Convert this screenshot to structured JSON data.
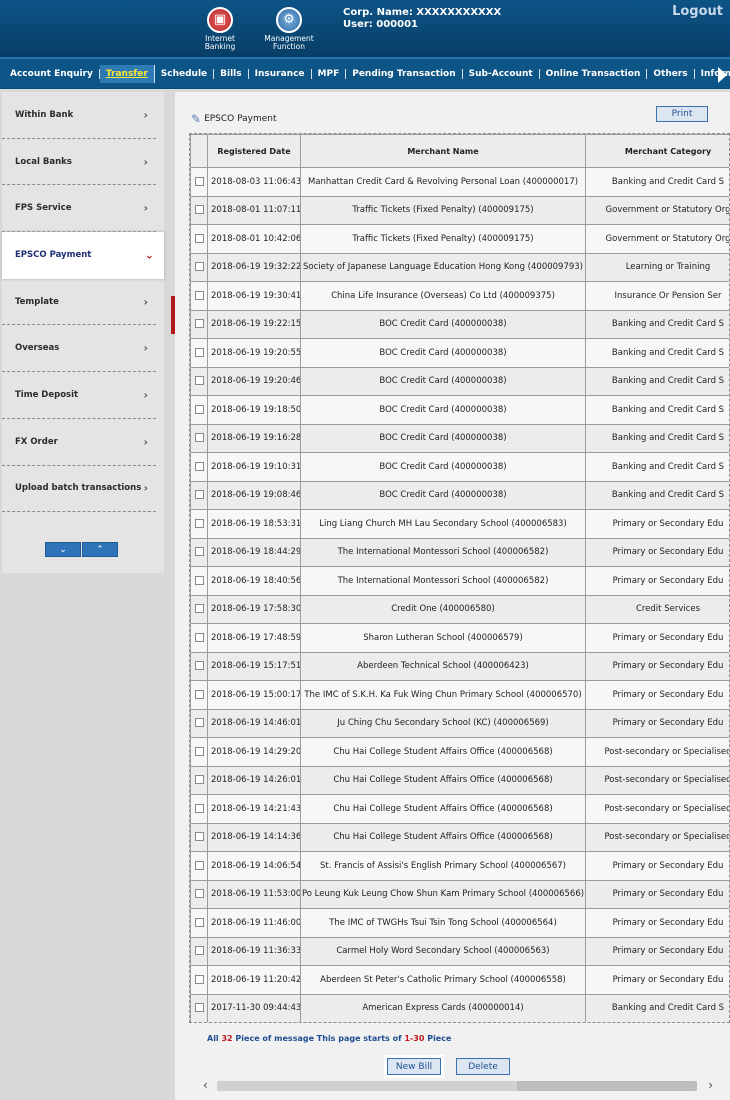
{
  "header": {
    "internet_banking": "Internet Banking",
    "management_function": "Management Function",
    "corp_name": "Corp. Name: XXXXXXXXXXX",
    "user": "User: 000001",
    "logout": "Logout"
  },
  "nav": [
    "Account Enquiry",
    "Transfer",
    "Schedule",
    "Bills",
    "Insurance",
    "MPF",
    "Pending Transaction",
    "Sub-Account",
    "Online Transaction",
    "Others",
    "Inform"
  ],
  "sidebar": {
    "items": [
      "Within Bank",
      "Local Banks",
      "FPS Service",
      "EPSCO Payment",
      "Template",
      "Overseas",
      "Time Deposit",
      "FX Order",
      "Upload batch transactions"
    ],
    "active": "EPSCO Payment"
  },
  "main": {
    "title": "EPSCO Payment",
    "print": "Print",
    "columns": [
      "Registered Date",
      "Merchant Name",
      "Merchant Category"
    ],
    "rows": [
      [
        "2018-08-03 11:06:43",
        "Manhattan Credit Card & Revolving Personal Loan (400000017)",
        "Banking and Credit Card S"
      ],
      [
        "2018-08-01 11:07:11",
        "Traffic Tickets (Fixed Penalty) (400009175)",
        "Government or Statutory Org"
      ],
      [
        "2018-08-01 10:42:06",
        "Traffic Tickets (Fixed Penalty) (400009175)",
        "Government or Statutory Org"
      ],
      [
        "2018-06-19 19:32:22",
        "Society of Japanese Language Education Hong Kong (400009793)",
        "Learning or Training"
      ],
      [
        "2018-06-19 19:30:41",
        "China Life Insurance (Overseas) Co Ltd (400009375)",
        "Insurance Or Pension Ser"
      ],
      [
        "2018-06-19 19:22:15",
        "BOC Credit Card (400000038)",
        "Banking and Credit Card S"
      ],
      [
        "2018-06-19 19:20:55",
        "BOC Credit Card (400000038)",
        "Banking and Credit Card S"
      ],
      [
        "2018-06-19 19:20:46",
        "BOC Credit Card (400000038)",
        "Banking and Credit Card S"
      ],
      [
        "2018-06-19 19:18:50",
        "BOC Credit Card (400000038)",
        "Banking and Credit Card S"
      ],
      [
        "2018-06-19 19:16:28",
        "BOC Credit Card (400000038)",
        "Banking and Credit Card S"
      ],
      [
        "2018-06-19 19:10:31",
        "BOC Credit Card (400000038)",
        "Banking and Credit Card S"
      ],
      [
        "2018-06-19 19:08:46",
        "BOC Credit Card (400000038)",
        "Banking and Credit Card S"
      ],
      [
        "2018-06-19 18:53:31",
        "Ling Liang Church MH Lau Secondary School (400006583)",
        "Primary or Secondary Edu"
      ],
      [
        "2018-06-19 18:44:29",
        "The International Montessori School (400006582)",
        "Primary or Secondary Edu"
      ],
      [
        "2018-06-19 18:40:56",
        "The International Montessori School (400006582)",
        "Primary or Secondary Edu"
      ],
      [
        "2018-06-19 17:58:30",
        "Credit One (400006580)",
        "Credit Services"
      ],
      [
        "2018-06-19 17:48:59",
        "Sharon Lutheran School (400006579)",
        "Primary or Secondary Edu"
      ],
      [
        "2018-06-19 15:17:51",
        "Aberdeen Technical School (400006423)",
        "Primary or Secondary Edu"
      ],
      [
        "2018-06-19 15:00:17",
        "The IMC of S.K.H. Ka Fuk Wing Chun Primary School (400006570)",
        "Primary or Secondary Edu"
      ],
      [
        "2018-06-19 14:46:01",
        "Ju Ching Chu Secondary School (KC) (400006569)",
        "Primary or Secondary Edu"
      ],
      [
        "2018-06-19 14:29:20",
        "Chu Hai College Student Affairs Office (400006568)",
        "Post-secondary or Specialised"
      ],
      [
        "2018-06-19 14:26:01",
        "Chu Hai College Student Affairs Office (400006568)",
        "Post-secondary or Specialised"
      ],
      [
        "2018-06-19 14:21:43",
        "Chu Hai College Student Affairs Office (400006568)",
        "Post-secondary or Specialised"
      ],
      [
        "2018-06-19 14:14:36",
        "Chu Hai College Student Affairs Office (400006568)",
        "Post-secondary or Specialised"
      ],
      [
        "2018-06-19 14:06:54",
        "St. Francis of Assisi's English Primary School (400006567)",
        "Primary or Secondary Edu"
      ],
      [
        "2018-06-19 11:53:00",
        "Po Leung Kuk Leung Chow Shun Kam Primary School (400006566)",
        "Primary or Secondary Edu"
      ],
      [
        "2018-06-19 11:46:00",
        "The IMC of TWGHs Tsui Tsin Tong School (400006564)",
        "Primary or Secondary Edu"
      ],
      [
        "2018-06-19 11:36:33",
        "Carmel Holy Word Secondary School (400006563)",
        "Primary or Secondary Edu"
      ],
      [
        "2018-06-19 11:20:42",
        "Aberdeen St Peter's Catholic Primary School (400006558)",
        "Primary or Secondary Edu"
      ],
      [
        "2017-11-30 09:44:43",
        "American Express Cards (400000014)",
        "Banking and Credit Card S"
      ]
    ],
    "pager": {
      "prefix": "All",
      "total": "32",
      "middle": "Piece of message This page starts of",
      "range": "1-30",
      "suffix": "Piece"
    },
    "new_bill": "New Bill",
    "delete": "Delete"
  }
}
